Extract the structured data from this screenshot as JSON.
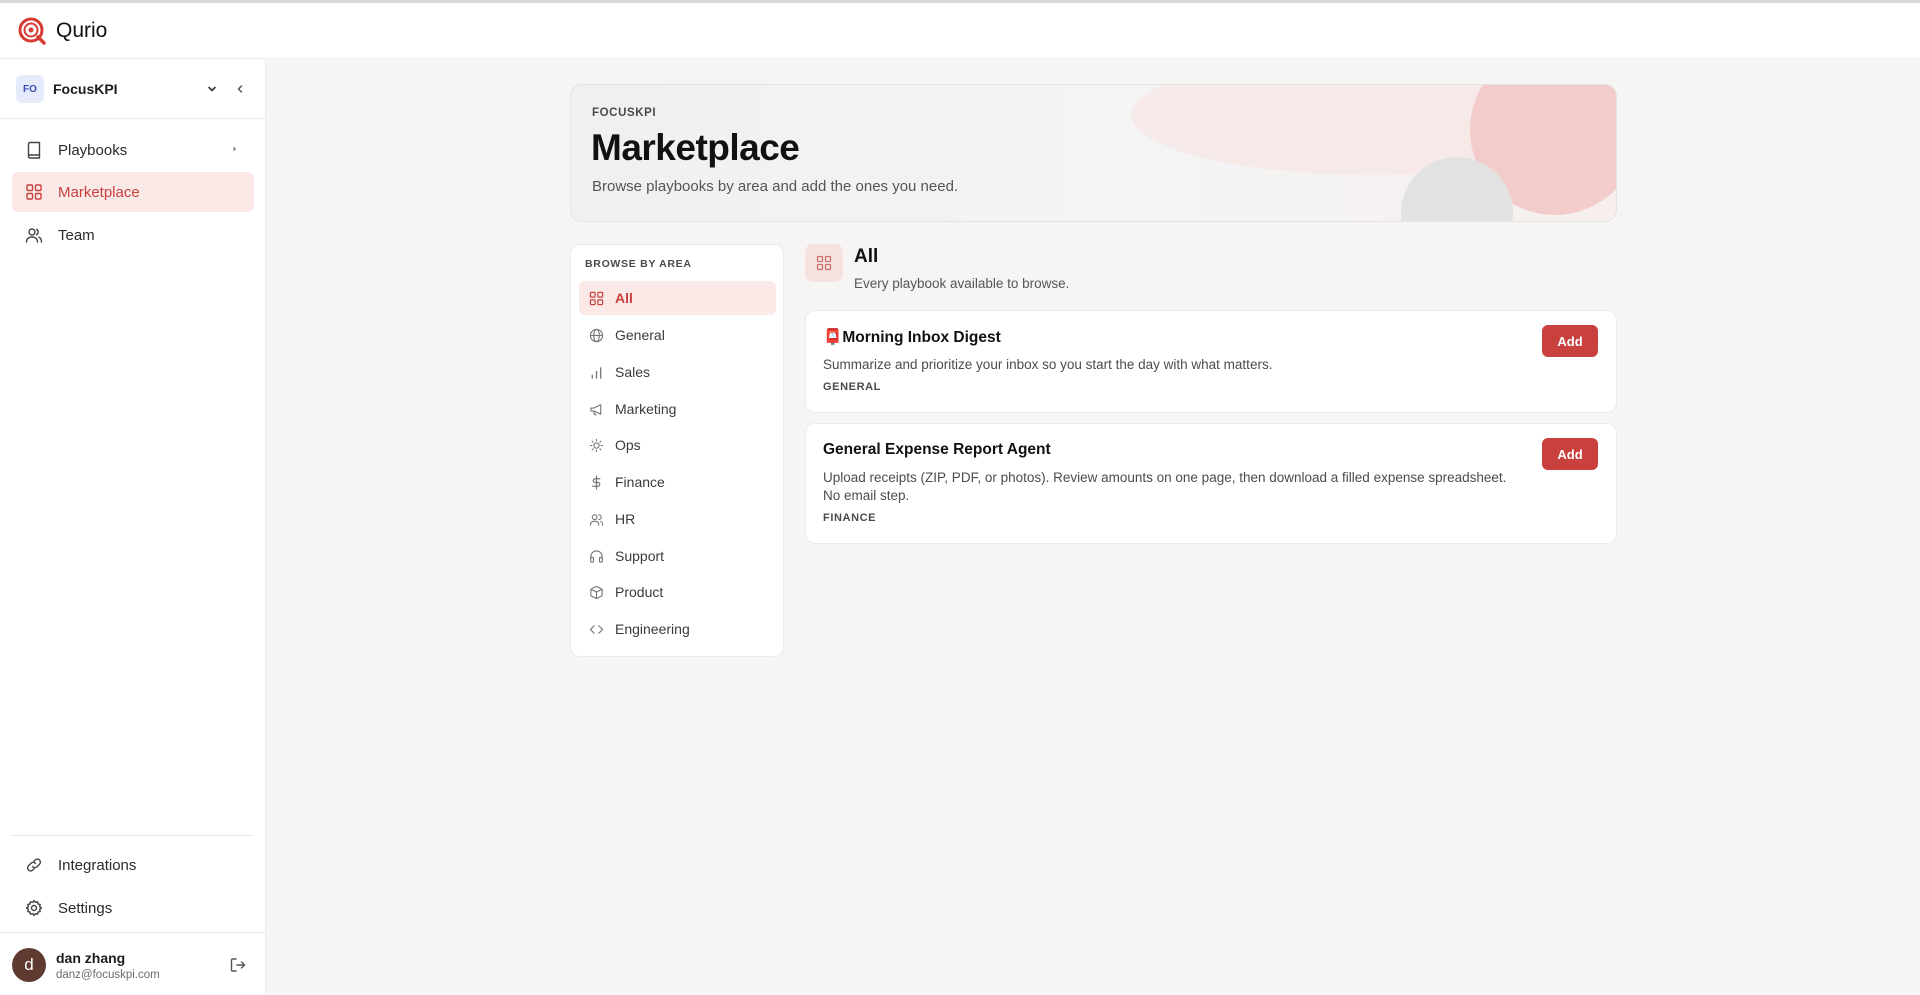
{
  "app": {
    "title": "Qurio"
  },
  "workspace": {
    "badge": "FO",
    "name": "FocusKPI"
  },
  "sidebar": {
    "nav": [
      {
        "label": "Playbooks",
        "icon": "book-icon"
      },
      {
        "label": "Marketplace",
        "icon": "grid-icon"
      },
      {
        "label": "Team",
        "icon": "users-icon"
      }
    ],
    "bottom": [
      {
        "label": "Integrations",
        "icon": "link-icon"
      },
      {
        "label": "Settings",
        "icon": "gear-icon"
      }
    ]
  },
  "user": {
    "initial": "d",
    "name": "dan zhang",
    "email": "danz@focuskpi.com"
  },
  "hero": {
    "org": "FOCUSKPI",
    "title": "Marketplace",
    "subtitle": "Browse playbooks by area and add the ones you need."
  },
  "areas": {
    "heading": "BROWSE BY AREA",
    "items": [
      {
        "label": "All",
        "icon": "grid-icon"
      },
      {
        "label": "General",
        "icon": "globe-icon"
      },
      {
        "label": "Sales",
        "icon": "bar-chart-icon"
      },
      {
        "label": "Marketing",
        "icon": "megaphone-icon"
      },
      {
        "label": "Ops",
        "icon": "sun-icon"
      },
      {
        "label": "Finance",
        "icon": "dollar-icon"
      },
      {
        "label": "HR",
        "icon": "users-icon"
      },
      {
        "label": "Support",
        "icon": "headphones-icon"
      },
      {
        "label": "Product",
        "icon": "box-icon"
      },
      {
        "label": "Engineering",
        "icon": "code-icon"
      }
    ]
  },
  "category": {
    "title": "All",
    "subtitle": "Every playbook available to browse."
  },
  "playbooks": [
    {
      "emoji": "📮",
      "title": "Morning Inbox Digest",
      "description": "Summarize and prioritize your inbox so you start the day with what matters.",
      "tag": "GENERAL",
      "button": "Add"
    },
    {
      "emoji": "",
      "title": "General Expense Report Agent",
      "description": "Upload receipts (ZIP, PDF, or photos). Review amounts on one page, then download a filled expense spreadsheet. No email step.",
      "tag": "FINANCE",
      "button": "Add"
    }
  ],
  "colors": {
    "accent": "#c8413e",
    "accent_bg": "#fbe9e8",
    "page_bg": "#f6f5f3"
  }
}
